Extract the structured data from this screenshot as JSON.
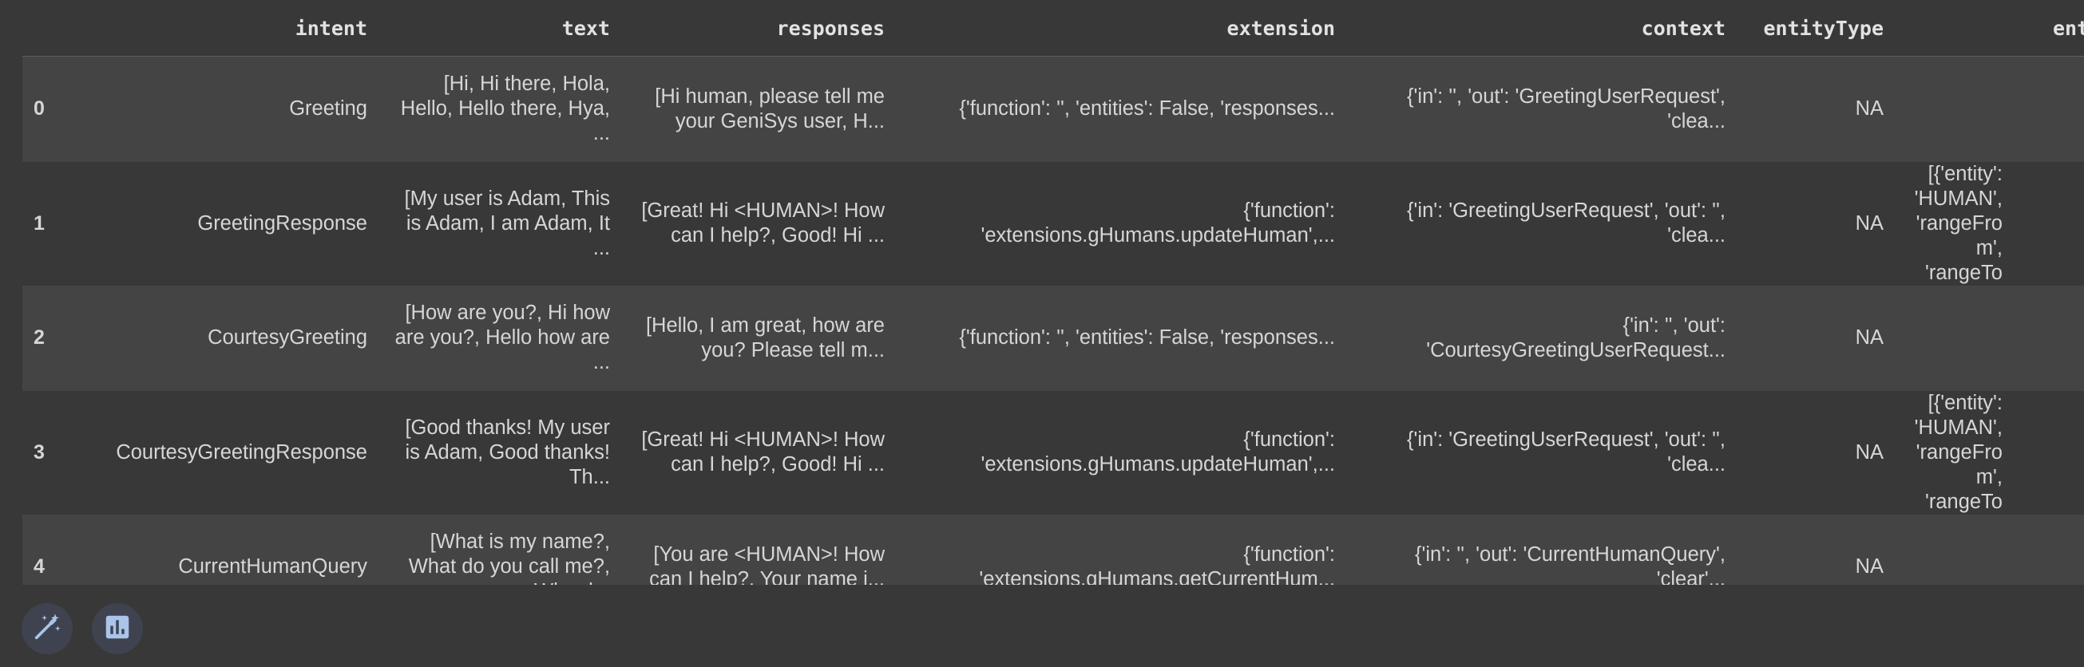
{
  "table": {
    "index_header": "",
    "columns": [
      "intent",
      "text",
      "responses",
      "extension",
      "context",
      "entityType",
      "entiti"
    ],
    "rows": [
      {
        "index": "0",
        "cells": [
          "Greeting",
          "[Hi, Hi there, Hola, Hello, Hello there, Hya, ...",
          "[Hi human, please tell me your GeniSys user, H...",
          "{'function': '', 'entities': False, 'responses...",
          "{'in': '', 'out': 'GreetingUserRequest', 'clea...",
          "NA",
          ""
        ]
      },
      {
        "index": "1",
        "cells": [
          "GreetingResponse",
          "[My user is Adam, This is Adam, I am Adam, It ...",
          "[Great! Hi <HUMAN>! How can I help?, Good! Hi ...",
          "{'function': 'extensions.gHumans.updateHuman',...",
          "{'in': 'GreetingUserRequest', 'out': '', 'clea...",
          "NA",
          "[{'entity': 'HUMAN', 'rangeFrom', 'rangeTo"
        ]
      },
      {
        "index": "2",
        "cells": [
          "CourtesyGreeting",
          "[How are you?, Hi how are you?, Hello how are ...",
          "[Hello, I am great, how are you? Please tell m...",
          "{'function': '', 'entities': False, 'responses...",
          "{'in': '', 'out': 'CourtesyGreetingUserRequest...",
          "NA",
          ""
        ]
      },
      {
        "index": "3",
        "cells": [
          "CourtesyGreetingResponse",
          "[Good thanks! My user is Adam, Good thanks! Th...",
          "[Great! Hi <HUMAN>! How can I help?, Good! Hi ...",
          "{'function': 'extensions.gHumans.updateHuman',...",
          "{'in': 'GreetingUserRequest', 'out': '', 'clea...",
          "NA",
          "[{'entity': 'HUMAN', 'rangeFrom', 'rangeTo"
        ]
      },
      {
        "index": "4",
        "cells": [
          "CurrentHumanQuery",
          "[What is my name?, What do you call me?, Who d...",
          "[You are <HUMAN>! How can I help?, Your name i...",
          "{'function': 'extensions.gHumans.getCurrentHum...",
          "{'in': '', 'out': 'CurrentHumanQuery', 'clear'...",
          "NA",
          ""
        ]
      }
    ]
  },
  "actions": {
    "wand_icon": "magic-wand-icon",
    "chart_icon": "bar-chart-icon"
  },
  "colors": {
    "background": "#383838",
    "row_alt": "#444444",
    "button_bg": "#3f4350",
    "icon": "#aac4ea"
  }
}
